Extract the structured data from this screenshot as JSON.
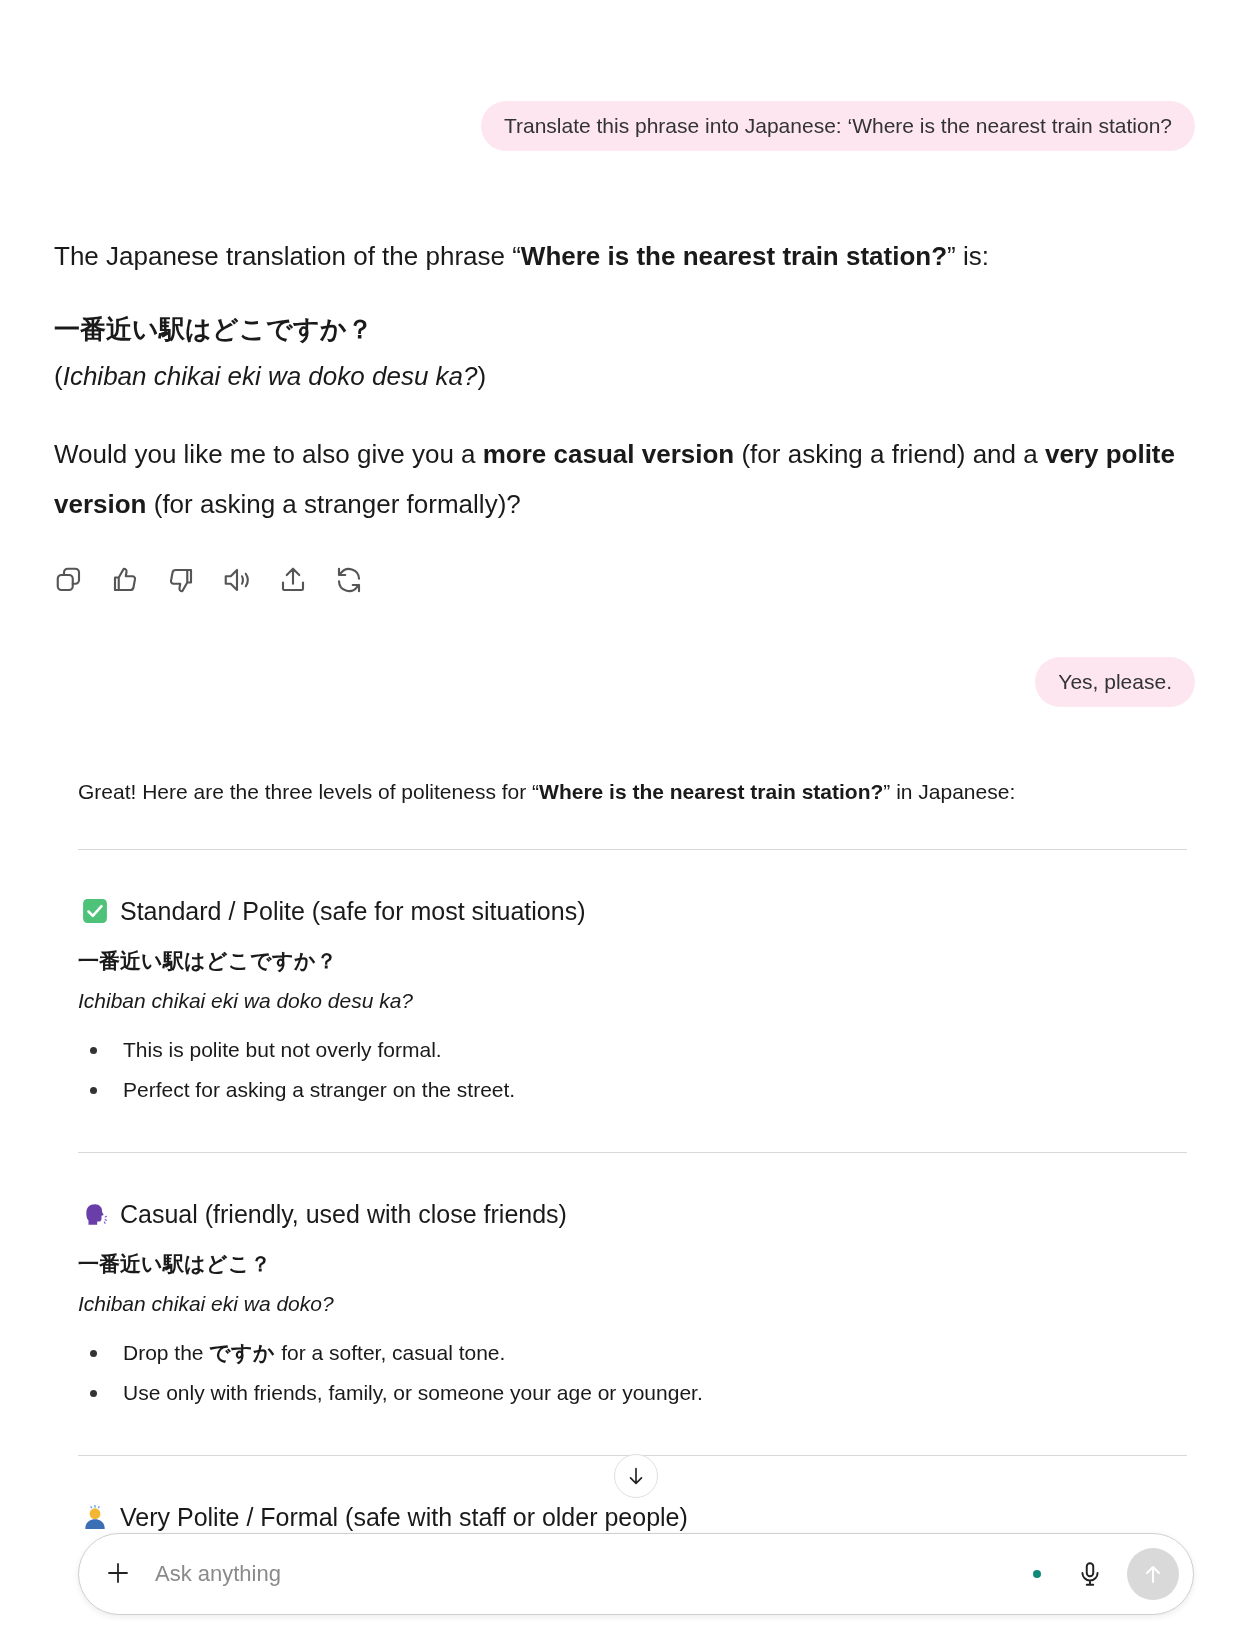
{
  "messages": [
    {
      "kind": "user",
      "text": "Translate this phrase into Japanese: ‘Where is the nearest train station?"
    },
    {
      "kind": "assistant",
      "paragraphs": [
        {
          "kind": "text",
          "text": "The Japanese translation of the phrase “**Where is the nearest train station?**” is:"
        },
        {
          "kind": "japanese",
          "text": "一番近い駅はどこですか？"
        },
        {
          "kind": "romaji",
          "text": "(*Ichiban chikai eki wa doko desu ka?*)"
        },
        {
          "kind": "text",
          "text": "Would you like me to also give you a **more casual version** (for asking a friend) and a **very polite version** (for asking a stranger formally)?"
        }
      ],
      "actions": [
        {
          "kind": "copy"
        },
        {
          "kind": "like"
        },
        {
          "kind": "dislike"
        },
        {
          "kind": "speak"
        },
        {
          "kind": "share"
        },
        {
          "kind": "regenerate"
        }
      ]
    },
    {
      "kind": "user",
      "text": "Yes, please."
    },
    {
      "kind": "assistant",
      "intro": "Great! Here are the three levels of politeness for “**Where is the nearest train station?**” in Japanese:",
      "sections": [
        {
          "kind": "check",
          "heading": "Standard / Polite (safe for most situations)",
          "japanese": "一番近い駅はどこですか？",
          "romaji": "Ichiban chikai eki wa doko desu ka?",
          "bullets": [
            "This is polite but not overly formal.",
            "Perfect for asking a stranger on the street."
          ]
        },
        {
          "kind": "speaking",
          "heading": "Casual (friendly, used with close friends)",
          "japanese": "一番近い駅はどこ？",
          "romaji": "Ichiban chikai eki wa doko?",
          "bullets": [
            "Drop the **ですか** for a softer, casual tone.",
            "Use only with friends, family, or someone your age or younger."
          ]
        },
        {
          "kind": "bowing",
          "heading": "Very Polite / Formal (safe with staff or older people)"
        }
      ]
    }
  ],
  "composer": {
    "placeholder": "Ask anything"
  }
}
